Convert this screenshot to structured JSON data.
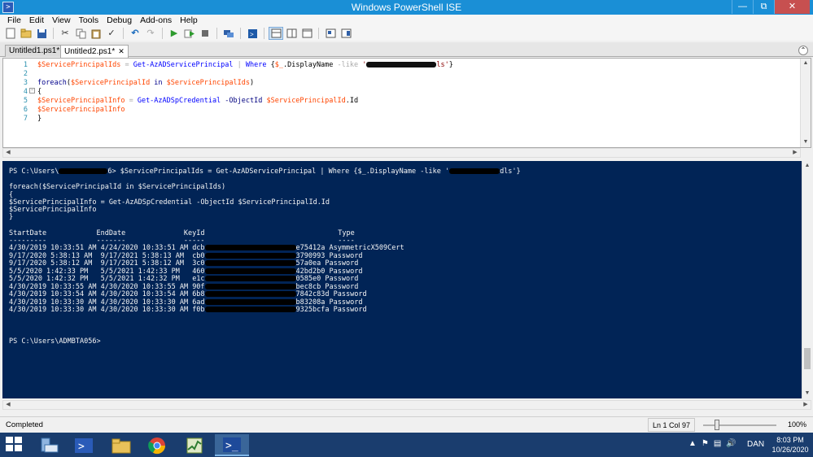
{
  "window": {
    "title": "Windows PowerShell ISE"
  },
  "menu": {
    "items": [
      "File",
      "Edit",
      "View",
      "Tools",
      "Debug",
      "Add-ons",
      "Help"
    ]
  },
  "tabs": [
    {
      "label": "Untitled1.ps1*",
      "active": false
    },
    {
      "label": "Untitled2.ps1*",
      "active": true
    }
  ],
  "editor": {
    "line_numbers": [
      "1",
      "2",
      "3",
      "4",
      "5",
      "6",
      "7"
    ],
    "lines": {
      "l1_var": "$ServicePrincipalIds",
      "l1_eq": " = ",
      "l1_cmd": "Get-AzADServicePrincipal",
      "l1_pipe": " | ",
      "l1_where": "Where",
      "l1_open": " {",
      "l1_dollar": "$_",
      "l1_prop": ".DisplayName ",
      "l1_op": "-like",
      "l1_str_start": " '",
      "l1_str_end": "ls'",
      "l1_close": "}",
      "l3_kw": "foreach",
      "l3_open": "(",
      "l3_var1": "$ServicePrincipalId",
      "l3_in": " in ",
      "l3_var2": "$ServicePrincipalIds",
      "l3_close": ")",
      "l4": "{",
      "l5_var": "$ServicePrincipalInfo",
      "l5_eq": " = ",
      "l5_cmd": "Get-AzADSpCredential",
      "l5_param": " -ObjectId ",
      "l5_arg": "$ServicePrincipalId",
      "l5_prop": ".Id",
      "l6": "$ServicePrincipalInfo",
      "l7": "}"
    }
  },
  "console": {
    "prompt1_start": "PS C:\\Users\\",
    "prompt1_cmd": "6> $ServicePrincipalIds = Get-AzADServicePrincipal | Where {$_.DisplayName -like '",
    "prompt1_end": "dls'}",
    "foreach_line": "foreach($ServicePrincipalId in $ServicePrincipalIds)",
    "brace_open": "{",
    "info_line": "$ServicePrincipalInfo = Get-AzADSpCredential -ObjectId $ServicePrincipalId.Id",
    "info_var": "$ServicePrincipalInfo",
    "brace_close": "}",
    "header": "StartDate            EndDate              KeyId                                Type",
    "underline": "---------            -------              -----                                ----",
    "rows": [
      {
        "start": "4/30/2019 10:33:51 AM",
        "end": "4/24/2020 10:33:51 AM",
        "key_head": "dcb",
        "key_tail": "e75412a",
        "type": "AsymmetricX509Cert"
      },
      {
        "start": "9/17/2020 5:38:13 AM ",
        "end": "9/17/2021 5:38:13 AM ",
        "key_head": "cb0",
        "key_tail": "3790993",
        "type": "Password"
      },
      {
        "start": "9/17/2020 5:38:12 AM ",
        "end": "9/17/2021 5:38:12 AM ",
        "key_head": "3c0",
        "key_tail": "57a0ea",
        "type": "Password"
      },
      {
        "start": "5/5/2020 1:42:33 PM  ",
        "end": "5/5/2021 1:42:33 PM  ",
        "key_head": "460",
        "key_tail": "42bd2b0",
        "type": "Password"
      },
      {
        "start": "5/5/2020 1:42:32 PM  ",
        "end": "5/5/2021 1:42:32 PM  ",
        "key_head": "e1c",
        "key_tail": "0585e0",
        "type": "Password"
      },
      {
        "start": "4/30/2019 10:33:55 AM",
        "end": "4/30/2020 10:33:55 AM",
        "key_head": "90f",
        "key_tail": "bec8cb",
        "type": "Password"
      },
      {
        "start": "4/30/2019 10:33:54 AM",
        "end": "4/30/2020 10:33:54 AM",
        "key_head": "6b8",
        "key_tail": "7842c83d",
        "type": "Password"
      },
      {
        "start": "4/30/2019 10:33:30 AM",
        "end": "4/30/2020 10:33:30 AM",
        "key_head": "6ad",
        "key_tail": "b83208a",
        "type": "Password"
      },
      {
        "start": "4/30/2019 10:33:30 AM",
        "end": "4/30/2020 10:33:30 AM",
        "key_head": "f0b",
        "key_tail": "9325bcfa",
        "type": "Password"
      }
    ],
    "prompt2": "PS C:\\Users\\ADMBTA056>"
  },
  "status": {
    "text": "Completed",
    "cursor": "Ln 1  Col 97",
    "zoom": "100%",
    "zoom_level_percent": 100
  },
  "taskbar": {
    "apps": [
      "server-manager-icon",
      "powershell-icon",
      "file-explorer-icon",
      "chrome-icon",
      "task-manager-icon",
      "powershell-ise-icon"
    ],
    "language": "DAN",
    "time": "8:03 PM",
    "date": "10/26/2020"
  }
}
